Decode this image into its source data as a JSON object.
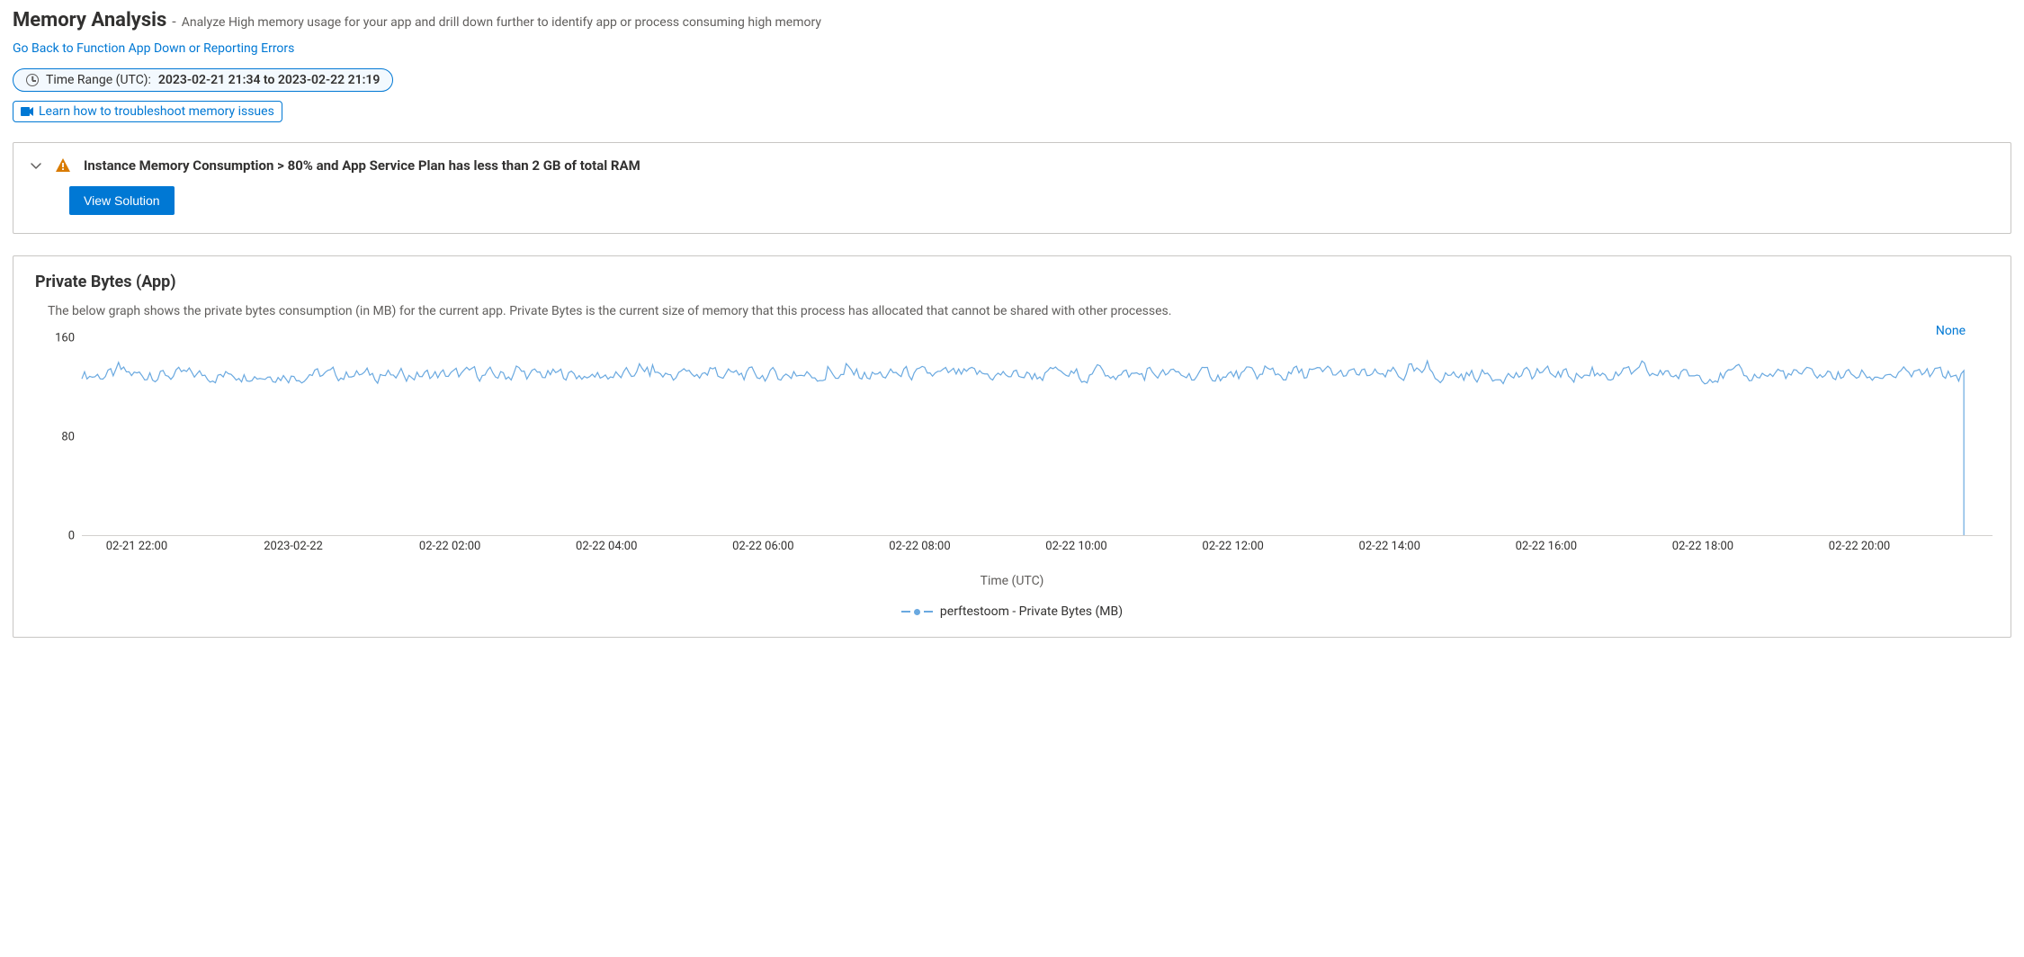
{
  "header": {
    "title": "Memory Analysis",
    "subtitle": "Analyze High memory usage for your app and drill down further to identify app or process consuming high memory"
  },
  "back_link": "Go Back to Function App Down or Reporting Errors",
  "time_range": {
    "label": "Time Range (UTC):",
    "value": "2023-02-21 21:34 to 2023-02-22 21:19"
  },
  "learn_link": "Learn how to troubleshoot memory issues",
  "alert": {
    "text": "Instance Memory Consumption > 80% and App Service Plan has less than 2 GB of total RAM",
    "button": "View Solution"
  },
  "chart": {
    "title": "Private Bytes (App)",
    "description": "The below graph shows the private bytes consumption (in MB) for the current app. Private Bytes is the current size of memory that this process has allocated that cannot be shared with other processes.",
    "none_label": "None",
    "xlabel": "Time (UTC)",
    "legend": "perftestoom - Private Bytes (MB)"
  },
  "chart_data": {
    "type": "line",
    "title": "Private Bytes (App)",
    "xlabel": "Time (UTC)",
    "ylabel": "",
    "ylim": [
      0,
      160
    ],
    "x_ticks": [
      "02-21 22:00",
      "2023-02-22",
      "02-22 02:00",
      "02-22 04:00",
      "02-22 06:00",
      "02-22 08:00",
      "02-22 10:00",
      "02-22 12:00",
      "02-22 14:00",
      "02-22 16:00",
      "02-22 18:00",
      "02-22 20:00"
    ],
    "y_ticks": [
      0,
      80,
      160
    ],
    "series": [
      {
        "name": "perftestoom - Private Bytes (MB)",
        "color": "#6aa9e0",
        "approx_value": 130,
        "approx_min": 120,
        "approx_max": 145,
        "end_value": 0,
        "note": "Values oscillate rapidly around ~130 MB for the full 24h window, with a final drop to 0 near 02-22 21:19."
      }
    ]
  }
}
